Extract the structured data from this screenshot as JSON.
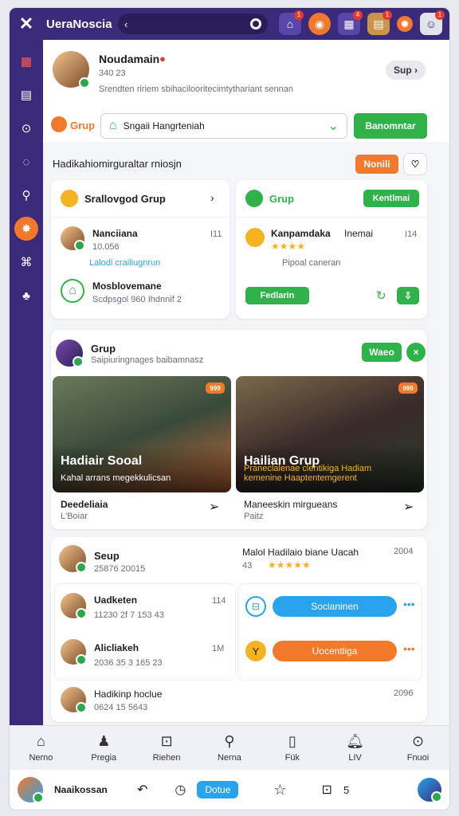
{
  "app": {
    "title": "UeraNoscia"
  },
  "search": {
    "chevron": "‹"
  },
  "top_icons": [
    {
      "name": "controller-icon",
      "badge": "1"
    },
    {
      "name": "coin-icon",
      "badge": ""
    },
    {
      "name": "calendar-icon",
      "badge": "4"
    },
    {
      "name": "briefcase-icon",
      "badge": "1"
    },
    {
      "name": "settings-icon",
      "badge": ""
    },
    {
      "name": "profile-icon",
      "badge": "1"
    }
  ],
  "profile": {
    "name": "Noudamain",
    "count": "340 23",
    "bio": "Srendten ririem sbihacilooritecimtythariant sennan",
    "sup_label": "Sup"
  },
  "group_bar": {
    "label": "Grup",
    "select_value": "Sngaii Hangrteniah",
    "action_label": "Banomntar"
  },
  "section": {
    "heading": "Hadikahiomirguraltar rniosjn",
    "btn_label": "Nonili"
  },
  "left_card": {
    "header": "Srallovgod Grup",
    "items": [
      {
        "name": "Nanciiana",
        "meta": "10.056",
        "time": "I11",
        "link": "Lalodi crailiugnrun"
      },
      {
        "name": "Mosblovemane",
        "meta": "Scdpsgol 960 Ihdnnif 2",
        "time": "",
        "link": ""
      }
    ]
  },
  "right_card": {
    "header": "Grup",
    "header_btn": "Kentlmai",
    "item": {
      "name": "Kanpamdaka",
      "sub": "Inemai",
      "time": "I14",
      "meta": "Pipoal caneran"
    },
    "btn_label": "Fedlarin"
  },
  "feed": {
    "author": "Grup",
    "sub": "Saipiuringnages baibamnasz",
    "follow_label": "Waeo",
    "posts": [
      {
        "title": "Hadiair Sooal",
        "sub": "Kahal arrans megekkulicsan",
        "caption": "Deedeliaia",
        "caption_sub": "L'Boiar",
        "tag": "999"
      },
      {
        "title": "Hailian Grup",
        "sub": "Praneclalenae clentikiga Hadiam kemenine Haaptentemgerent",
        "caption": "Maneeskin mirgueans",
        "caption_sub": "Paitz",
        "tag": "999"
      }
    ]
  },
  "bottom_card": {
    "top_name": "Seup",
    "top_meta": "25876  20015",
    "top_right": "Malol Hadilaio biane Uacah",
    "top_right_time": "2004",
    "rating": "43",
    "items": [
      {
        "name": "Uadketen",
        "meta": "11230 2f 7 153 43",
        "time": "114"
      },
      {
        "name": "Alicliakeh",
        "meta": "2036 35 3 165 23",
        "time": "1M"
      }
    ],
    "btn_blue": "Socianinen",
    "btn_orange": "Uocentliga",
    "footer_name": "Hadikinp hoclue",
    "footer_meta": "0624 15 5643",
    "footer_time": "2096"
  },
  "nav": [
    {
      "label": "Nerno",
      "icon": "home-icon"
    },
    {
      "label": "Pregia",
      "icon": "person-icon"
    },
    {
      "label": "Riehen",
      "icon": "bag-icon"
    },
    {
      "label": "Nerna",
      "icon": "search-icon"
    },
    {
      "label": "Fük",
      "icon": "phone-icon"
    },
    {
      "label": "LIV",
      "icon": "bell-icon"
    },
    {
      "label": "Fnuoi",
      "icon": "settings-icon"
    }
  ],
  "status": {
    "user": "Naaikossan",
    "pill": "Dotue",
    "count": "5"
  },
  "colors": {
    "primary": "#3b2a7a",
    "accent": "#f2782b",
    "success": "#2fb24a",
    "info": "#2aa3ee"
  }
}
